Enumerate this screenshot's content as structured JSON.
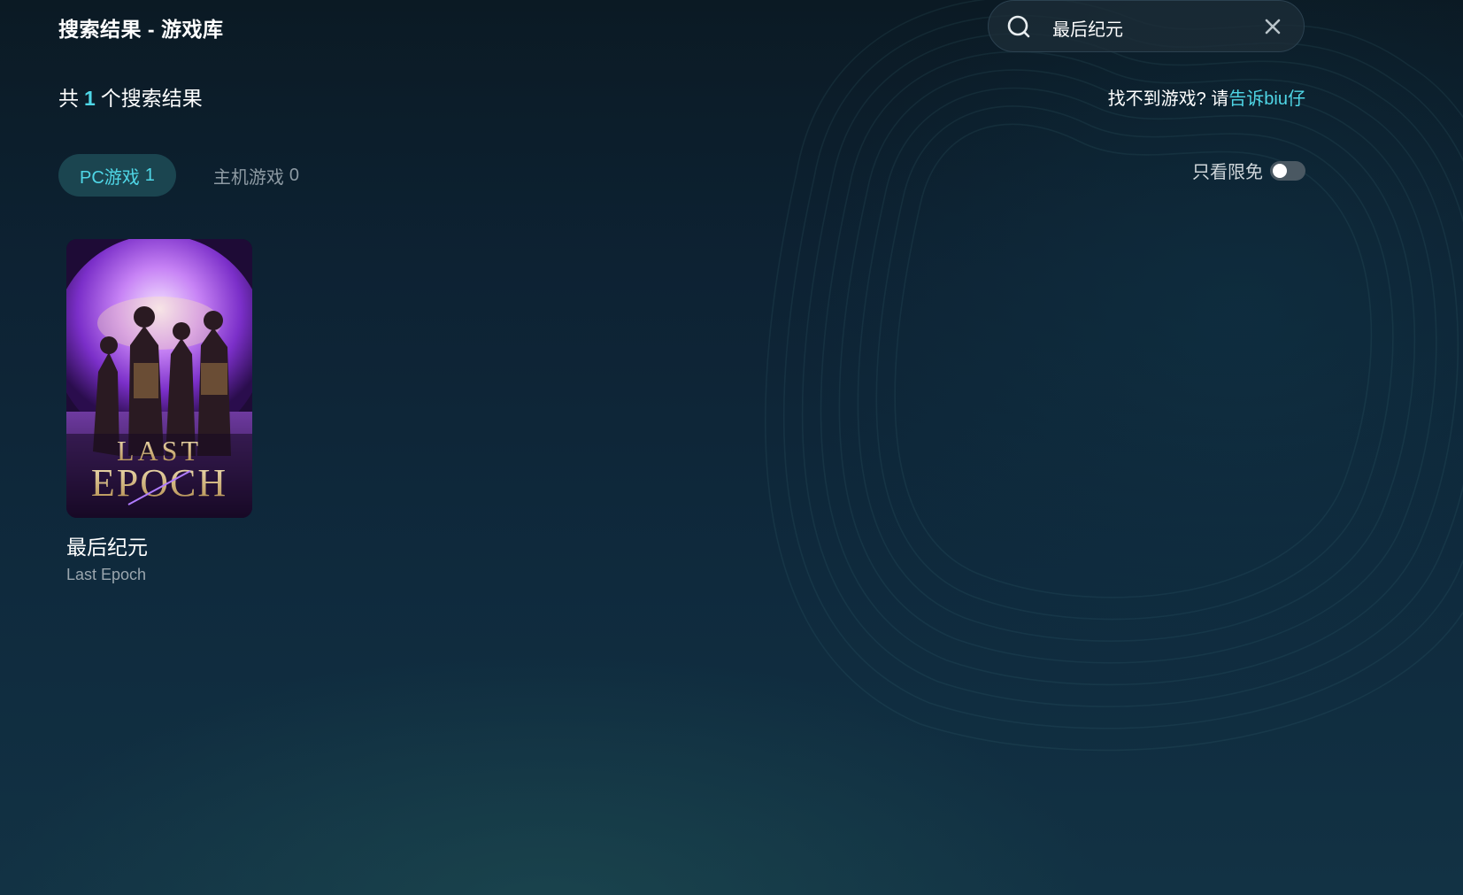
{
  "header": {
    "title": "搜索结果 - 游戏库"
  },
  "search": {
    "value": "最后纪元",
    "placeholder": ""
  },
  "results": {
    "prefix": "共",
    "count": "1",
    "suffix": "个搜索结果"
  },
  "help": {
    "text": "找不到游戏? 请",
    "link": "告诉biu仔"
  },
  "tabs": [
    {
      "label": "PC游戏",
      "count": "1",
      "active": true
    },
    {
      "label": "主机游戏",
      "count": "0",
      "active": false
    }
  ],
  "filter": {
    "label": "只看限免",
    "enabled": false
  },
  "games": [
    {
      "name": "最后纪元",
      "name_en": "Last Epoch",
      "cover_logo_line1": "LAST",
      "cover_logo_line2": "EPOCH"
    }
  ],
  "colors": {
    "accent": "#4fd6e6",
    "tab_active_bg": "#1b4550",
    "cover_purple": "#8a3fd6"
  }
}
